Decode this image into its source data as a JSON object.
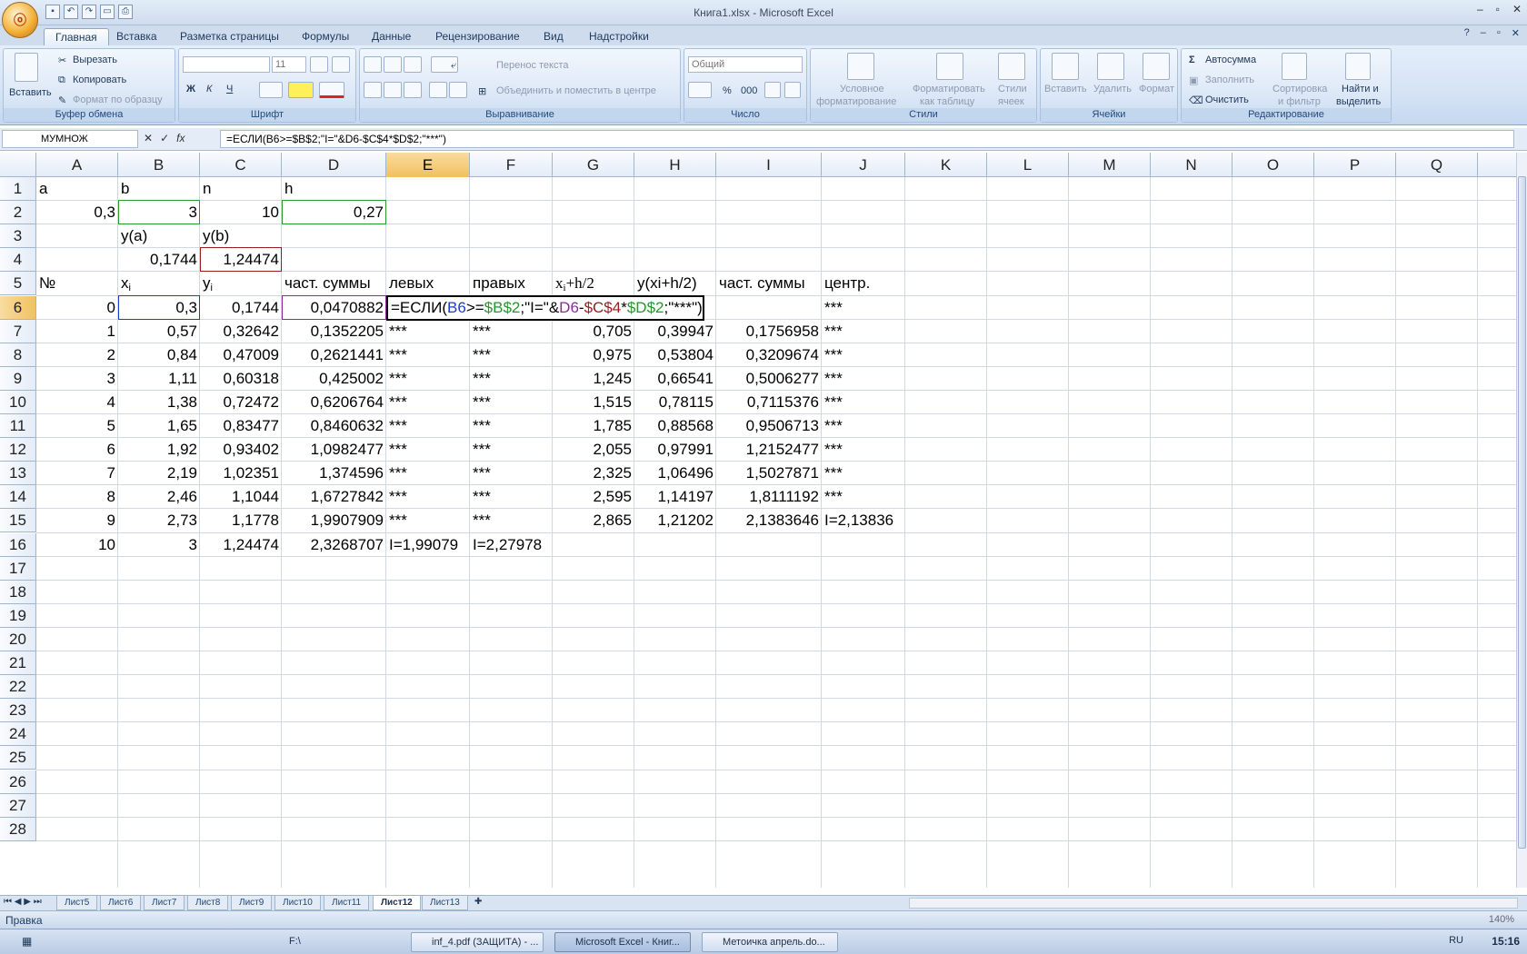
{
  "window": {
    "title": "Книга1.xlsx - Microsoft Excel",
    "office_button": "ⓞ"
  },
  "tabs": [
    "Главная",
    "Вставка",
    "Разметка страницы",
    "Формулы",
    "Данные",
    "Рецензирование",
    "Вид",
    "Надстройки"
  ],
  "ribbon": {
    "clipboard": {
      "label": "Буфер обмена",
      "paste": "Вставить",
      "cut": "Вырезать",
      "copy": "Копировать",
      "format_painter": "Формат по образцу"
    },
    "font": {
      "label": "Шрифт",
      "font_name": "",
      "font_size": "11",
      "bold": "Ж",
      "italic": "К",
      "underline": "Ч"
    },
    "alignment": {
      "label": "Выравнивание",
      "wrap": "Перенос текста",
      "merge": "Объединить и поместить в центре"
    },
    "number": {
      "label": "Число",
      "format": "Общий",
      "percent": "%",
      "thousands": "000"
    },
    "styles": {
      "label": "Стили",
      "conditional": "Условное",
      "conditional2": "форматирование",
      "as_table": "Форматировать",
      "as_table2": "как таблицу",
      "cell_styles": "Стили",
      "cell_styles2": "ячеек"
    },
    "cells": {
      "label": "Ячейки",
      "insert": "Вставить",
      "delete": "Удалить",
      "format": "Формат"
    },
    "editing": {
      "label": "Редактирование",
      "autosum": "Автосумма",
      "fill": "Заполнить",
      "clear": "Очистить",
      "sort": "Сортировка",
      "sort2": "и фильтр",
      "find": "Найти и",
      "find2": "выделить"
    }
  },
  "formula_bar": {
    "name_box": "МУМНОЖ",
    "formula": "=ЕСЛИ(B6>=$B$2;\"I=\"&D6-$C$4*$D$2;\"***\")"
  },
  "columns": [
    "A",
    "B",
    "C",
    "D",
    "E",
    "F",
    "G",
    "H",
    "I",
    "J",
    "K",
    "L",
    "M",
    "N",
    "O",
    "P",
    "Q"
  ],
  "rows": [
    "1",
    "2",
    "3",
    "4",
    "5",
    "6",
    "7",
    "8",
    "9",
    "10",
    "11",
    "12",
    "13",
    "14",
    "15",
    "16",
    "17",
    "18",
    "19",
    "20",
    "21",
    "22",
    "23",
    "24",
    "25",
    "26",
    "27",
    "28"
  ],
  "cells": {
    "A1": "a",
    "B1": "b",
    "C1": "n",
    "D1": "h",
    "A2": "0,3",
    "B2": "3",
    "C2": "10",
    "D2": "0,27",
    "B3": "y(a)",
    "C3": "y(b)",
    "B4": "0,1744",
    "C4": "1,24474",
    "A5": "№",
    "B5": "x",
    "B5s": "i",
    "C5": "y",
    "C5s": "i",
    "D5": "част. суммы",
    "E5": "левых",
    "F5": "правых",
    "G5": "x",
    "G5s": "i",
    "G5t": "+h/2",
    "H5": "y(xi+h/2)",
    "I5": "част. суммы",
    "J5": "центр.",
    "A6": "0",
    "B6": "0,3",
    "C6": "0,1744",
    "D6": "0,0470882",
    "J6": "***",
    "A7": "1",
    "B7": "0,57",
    "C7": "0,32642",
    "D7": "0,1352205",
    "E7": "***",
    "F7": "***",
    "G7": "0,705",
    "H7": "0,39947",
    "I7": "0,1756958",
    "J7": "***",
    "A8": "2",
    "B8": "0,84",
    "C8": "0,47009",
    "D8": "0,2621441",
    "E8": "***",
    "F8": "***",
    "G8": "0,975",
    "H8": "0,53804",
    "I8": "0,3209674",
    "J8": "***",
    "A9": "3",
    "B9": "1,11",
    "C9": "0,60318",
    "D9": "0,425002",
    "E9": "***",
    "F9": "***",
    "G9": "1,245",
    "H9": "0,66541",
    "I9": "0,5006277",
    "J9": "***",
    "A10": "4",
    "B10": "1,38",
    "C10": "0,72472",
    "D10": "0,6206764",
    "E10": "***",
    "F10": "***",
    "G10": "1,515",
    "H10": "0,78115",
    "I10": "0,7115376",
    "J10": "***",
    "A11": "5",
    "B11": "1,65",
    "C11": "0,83477",
    "D11": "0,8460632",
    "E11": "***",
    "F11": "***",
    "G11": "1,785",
    "H11": "0,88568",
    "I11": "0,9506713",
    "J11": "***",
    "A12": "6",
    "B12": "1,92",
    "C12": "0,93402",
    "D12": "1,0982477",
    "E12": "***",
    "F12": "***",
    "G12": "2,055",
    "H12": "0,97991",
    "I12": "1,2152477",
    "J12": "***",
    "A13": "7",
    "B13": "2,19",
    "C13": "1,02351",
    "D13": "1,374596",
    "E13": "***",
    "F13": "***",
    "G13": "2,325",
    "H13": "1,06496",
    "I13": "1,5027871",
    "J13": "***",
    "A14": "8",
    "B14": "2,46",
    "C14": "1,1044",
    "D14": "1,6727842",
    "E14": "***",
    "F14": "***",
    "G14": "2,595",
    "H14": "1,14197",
    "I14": "1,8111192",
    "J14": "***",
    "A15": "9",
    "B15": "2,73",
    "C15": "1,1778",
    "D15": "1,9907909",
    "E15": "***",
    "F15": "***",
    "G15": "2,865",
    "H15": "1,21202",
    "I15": "2,1383646",
    "J15": "I=2,13836",
    "A16": "10",
    "B16": "3",
    "C16": "1,24474",
    "D16": "2,3268707",
    "E16": "I=1,99079",
    "F16": "I=2,27978"
  },
  "edit_cell": {
    "p1": "=ЕСЛИ(",
    "p2": "B6",
    "p3": ">=",
    "p4": "$B$2",
    "p5": ";\"I=\"&",
    "p6": "D6",
    "p7": "-",
    "p8": "$C$4",
    "p9": "*",
    "p10": "$D$2",
    "p11": ";\"***\")",
    "colors": {
      "b6": "#1f3bd6",
      "b2": "#1f9a2a",
      "d6": "#8a2a9e",
      "c4": "#9a1c1c",
      "d2": "#1f9a2a"
    }
  },
  "sheet_tabs": [
    "Лист5",
    "Лист6",
    "Лист7",
    "Лист8",
    "Лист9",
    "Лист10",
    "Лист11",
    "Лист12",
    "Лист13"
  ],
  "active_sheet": "Лист12",
  "status": {
    "mode": "Правка",
    "zoom": "140%"
  },
  "taskbar": {
    "items": [
      "F:\\",
      "inf_4.pdf (ЗАЩИТА) - ...",
      "Microsoft Excel - Книг...",
      "Метоичка апрель.do..."
    ],
    "lang": "RU",
    "clock": "15:16"
  }
}
